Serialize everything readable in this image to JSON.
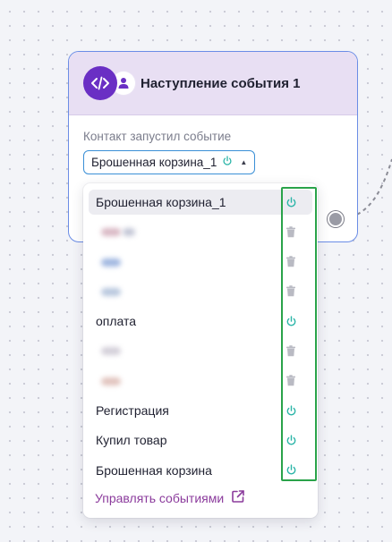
{
  "node": {
    "title": "Наступление события 1",
    "field_label": "Контакт запустил событие",
    "selected_event": "Брошенная корзина_1",
    "icons": {
      "header_left": "code-icon",
      "header_right": "user-icon",
      "caret": "caret-up-icon",
      "status": "power-icon"
    }
  },
  "dropdown": {
    "items": [
      {
        "label": "Брошенная корзина_1",
        "action_icon": "power-icon",
        "selected": true
      },
      {
        "label": "",
        "action_icon": "trash-icon",
        "blur_colors": [
          "#d9b8c4",
          "#c3c6d6"
        ]
      },
      {
        "label": "",
        "action_icon": "trash-icon",
        "blur_colors": [
          "#9fb6e0"
        ]
      },
      {
        "label": "",
        "action_icon": "trash-icon",
        "blur_colors": [
          "#b8c7de"
        ]
      },
      {
        "label": "оплата",
        "action_icon": "power-icon"
      },
      {
        "label": "",
        "action_icon": "trash-icon",
        "blur_colors": [
          "#d3cfd9"
        ]
      },
      {
        "label": "",
        "action_icon": "trash-icon",
        "blur_colors": [
          "#e1c3bd"
        ]
      },
      {
        "label": "Регистрация",
        "action_icon": "power-icon"
      },
      {
        "label": "Купил товар",
        "action_icon": "power-icon"
      },
      {
        "label": "Брошенная корзина",
        "action_icon": "power-icon"
      }
    ],
    "manage_link": "Управлять событиями",
    "manage_icon": "external-link-icon"
  },
  "colors": {
    "accent_purple": "#6a2fc4",
    "link_purple": "#8b3b9c",
    "power_teal": "#2bb5a8",
    "trash_gray": "#b9bac3",
    "highlight_green": "#2aa34a",
    "node_border": "#6b8de6"
  }
}
